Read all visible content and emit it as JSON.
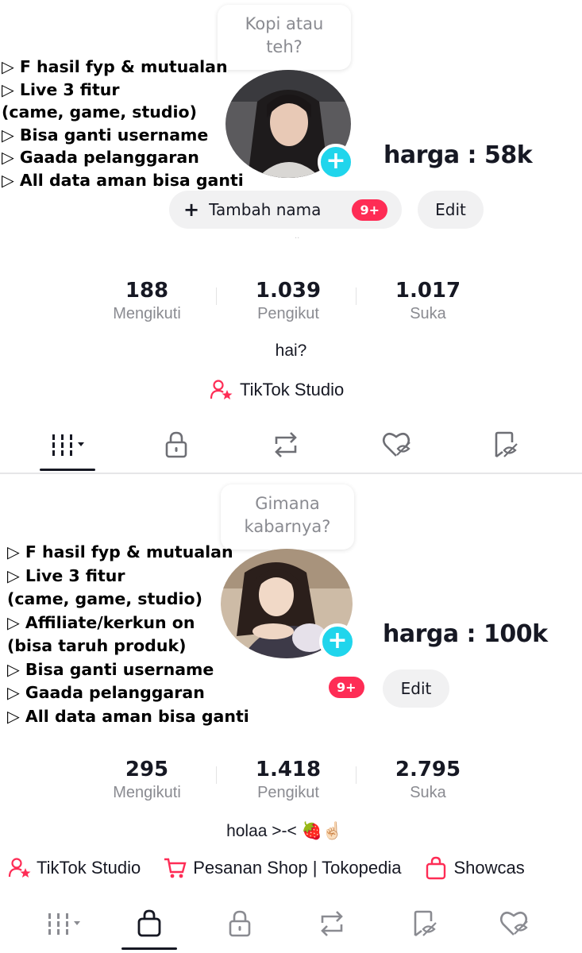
{
  "colors": {
    "accent_pink": "#fe2c55",
    "plus_cyan": "#20d5ec",
    "muted_text": "#8a8b91",
    "pill_bg": "#f1f1f2"
  },
  "listings": [
    {
      "bubble_lines": [
        "Kopi atau",
        "teh?"
      ],
      "features": [
        "▷ F hasil fyp & mutualan",
        "▷ Live 3 fitur",
        "(came, game, studio)",
        "▷ Bisa ganti username",
        "▷ Gaada pelanggaran",
        "▷ All data aman bisa ganti"
      ],
      "price": "harga : 58k",
      "add_name_label": "Tambah nama",
      "notif_badge": "9+",
      "edit_label": "Edit",
      "stats": [
        {
          "value": "188",
          "label": "Mengikuti"
        },
        {
          "value": "1.039",
          "label": "Pengikut"
        },
        {
          "value": "1.017",
          "label": "Suka"
        }
      ],
      "bio": "hai?",
      "links": [
        "TikTok Studio"
      ],
      "tabs": [
        "videos-grid-icon",
        "lock-icon",
        "repost-icon",
        "liked-icon",
        "favorites-icon"
      ]
    },
    {
      "bubble_lines": [
        "Gimana",
        "kabarnya?"
      ],
      "features": [
        "▷ F hasil fyp & mutualan",
        "▷ Live 3 fitur",
        "(came, game, studio)",
        "▷ Affiliate/kerkun on",
        "(bisa taruh produk)",
        "▷ Bisa ganti username",
        "▷ Gaada pelanggaran",
        "▷ All data aman bisa ganti"
      ],
      "price": "harga : 100k",
      "notif_badge": "9+",
      "edit_label": "Edit",
      "stats": [
        {
          "value": "295",
          "label": "Mengikuti"
        },
        {
          "value": "1.418",
          "label": "Pengikut"
        },
        {
          "value": "2.795",
          "label": "Suka"
        }
      ],
      "bio": "holaa >-< 🍓☝🏻",
      "links": [
        "TikTok Studio",
        "Pesanan Shop | Tokopedia",
        "Showcas"
      ],
      "tabs": [
        "videos-grid-icon",
        "shop-bag-icon",
        "lock-icon",
        "repost-icon",
        "favorites-icon",
        "liked-icon"
      ]
    }
  ]
}
